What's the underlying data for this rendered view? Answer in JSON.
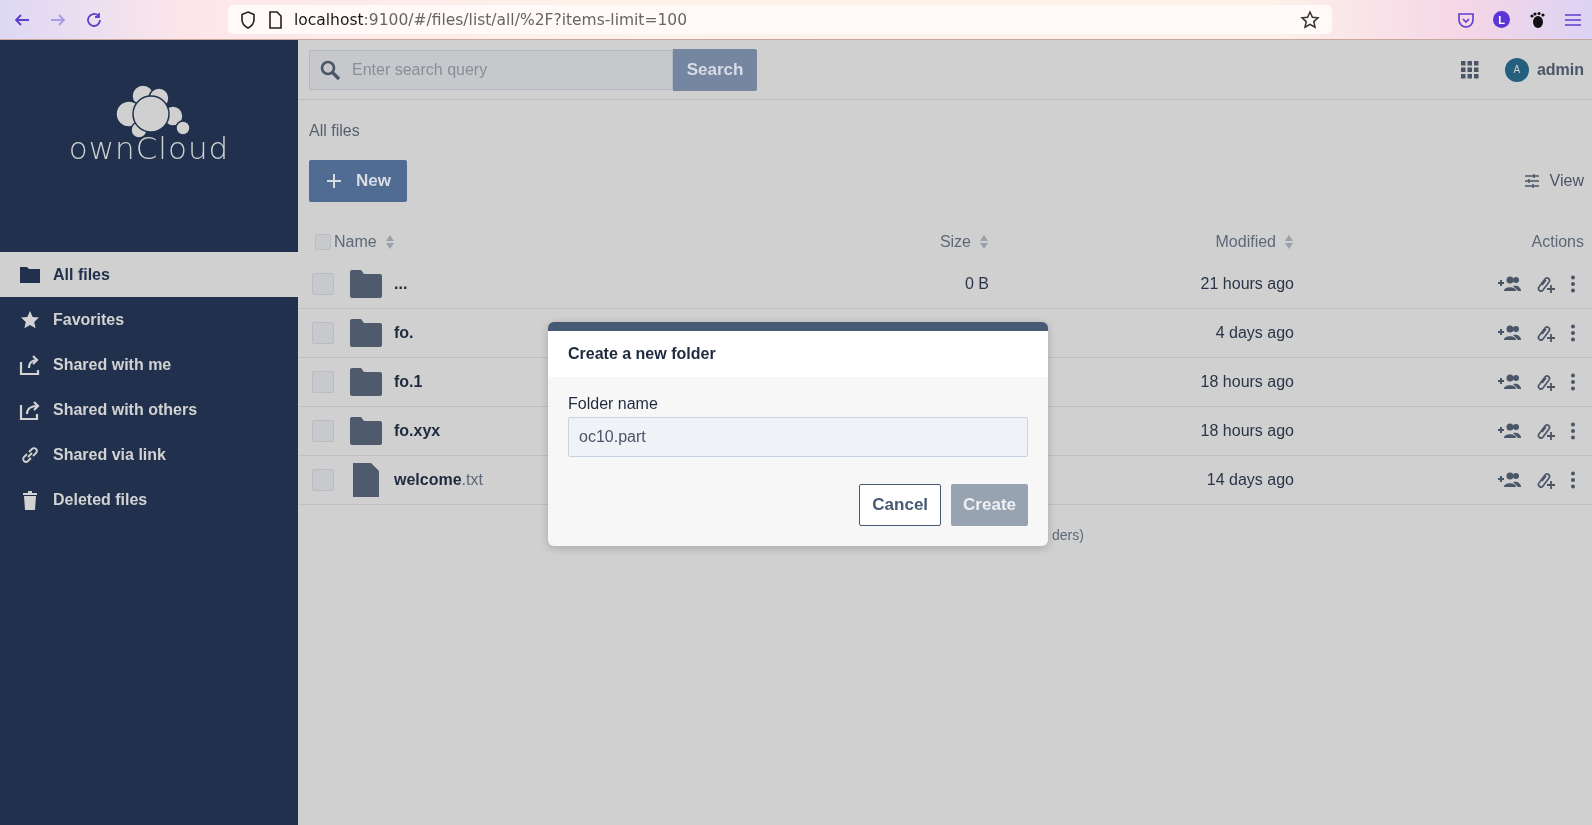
{
  "browser": {
    "url_host": "localhost",
    "url_rest": ":9100/#/files/list/all/%2F?items-limit=100",
    "profile_initial": "L"
  },
  "sidebar": {
    "logo": "ownCloud",
    "items": [
      {
        "label": "All files",
        "selected": true
      },
      {
        "label": "Favorites",
        "selected": false
      },
      {
        "label": "Shared with me",
        "selected": false
      },
      {
        "label": "Shared with others",
        "selected": false
      },
      {
        "label": "Shared via link",
        "selected": false
      },
      {
        "label": "Deleted files",
        "selected": false
      }
    ]
  },
  "topbar": {
    "search": {
      "placeholder": "Enter search query",
      "button": "Search"
    },
    "user": {
      "initial": "A",
      "name": "admin"
    }
  },
  "breadcrumb": "All files",
  "new_button": "New",
  "view_button": "View",
  "table": {
    "select_all_checked": false,
    "columns": [
      {
        "label": "Name",
        "sortable": true
      },
      {
        "label": "Size",
        "sortable": true
      },
      {
        "label": "Modified",
        "sortable": true
      },
      {
        "label": "Actions",
        "sortable": false
      }
    ],
    "rows": [
      {
        "kind": "folder",
        "name": "...",
        "size": "0 B",
        "modified": "21 hours ago",
        "checked": false
      },
      {
        "kind": "folder",
        "name": "fo.",
        "modified": "4 days ago",
        "checked": false
      },
      {
        "kind": "folder",
        "name": "fo.1",
        "modified": "18 hours ago",
        "checked": false
      },
      {
        "kind": "folder",
        "name": "fo.xyx",
        "modified": "18 hours ago",
        "checked": false
      },
      {
        "kind": "file",
        "name": "welcome",
        "extension": ".txt",
        "modified": "14 days ago",
        "checked": false
      }
    ],
    "footer": "ders)"
  },
  "dialog": {
    "title": "Create a new folder",
    "field_label": "Folder name",
    "value": "oc10.part",
    "buttons": [
      {
        "label": "Cancel",
        "kind": "secondary",
        "disabled": false
      },
      {
        "label": "Create",
        "kind": "primary",
        "disabled": true
      }
    ]
  }
}
